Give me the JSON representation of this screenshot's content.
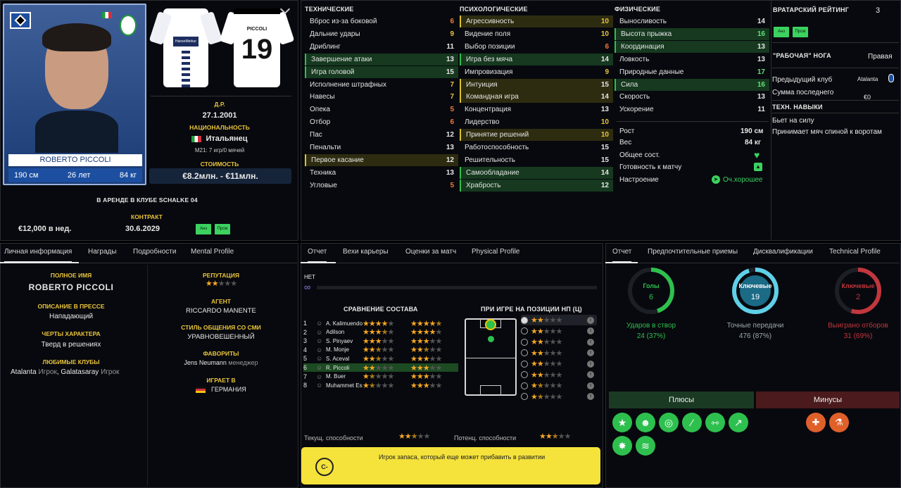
{
  "card": {
    "name": "ROBERTO PICCOLI",
    "height": "190 см",
    "age": "26 лет",
    "weight": "84 кг"
  },
  "dob_label": "Д.Р.",
  "dob": "27.1.2001",
  "nat_label": "НАЦИОНАЛЬНОСТЬ",
  "nationality": "Итальянец",
  "u21": "М21: 7 игр/0 мячей",
  "value_label": "СТОИМОСТЬ",
  "value": "€8.2млн. - €11млн.",
  "loan": "В АРЕНДЕ В КЛУБЕ SCHALKE 04",
  "contract_label": "КОНТРАКТ",
  "contract_date": "30.6.2029",
  "wage": "€12,000 в нед.",
  "badges": {
    "a": "Анз",
    "b": "Прсм"
  },
  "shirt_number": "19",
  "shirt_name": "PICCOLI",
  "sponsor": "HanseMerkur",
  "tech": {
    "title": "ТЕХНИЧЕСКИЕ",
    "items": [
      {
        "n": "Вброс из-за боковой",
        "v": "6"
      },
      {
        "n": "Дальние удары",
        "v": "9"
      },
      {
        "n": "Дриблинг",
        "v": "11"
      },
      {
        "n": "Завершение атаки",
        "v": "13"
      },
      {
        "n": "Игра головой",
        "v": "15"
      },
      {
        "n": "Исполнение штрафных",
        "v": "7"
      },
      {
        "n": "Навесы",
        "v": "7"
      },
      {
        "n": "Опека",
        "v": "5"
      },
      {
        "n": "Отбор",
        "v": "6"
      },
      {
        "n": "Пас",
        "v": "12"
      },
      {
        "n": "Пенальти",
        "v": "13"
      },
      {
        "n": "Первое касание",
        "v": "12"
      },
      {
        "n": "Техника",
        "v": "13"
      },
      {
        "n": "Угловые",
        "v": "5"
      }
    ]
  },
  "ment": {
    "title": "ПСИХОЛОГИЧЕСКИЕ",
    "items": [
      {
        "n": "Агрессивность",
        "v": "10"
      },
      {
        "n": "Видение поля",
        "v": "10"
      },
      {
        "n": "Выбор позиции",
        "v": "6"
      },
      {
        "n": "Игра без мяча",
        "v": "14"
      },
      {
        "n": "Импровизация",
        "v": "9"
      },
      {
        "n": "Интуиция",
        "v": "15"
      },
      {
        "n": "Командная игра",
        "v": "14"
      },
      {
        "n": "Концентрация",
        "v": "13"
      },
      {
        "n": "Лидерство",
        "v": "10"
      },
      {
        "n": "Принятие решений",
        "v": "10"
      },
      {
        "n": "Работоспособность",
        "v": "15"
      },
      {
        "n": "Решительность",
        "v": "15"
      },
      {
        "n": "Самообладание",
        "v": "14"
      },
      {
        "n": "Храбрость",
        "v": "12"
      }
    ]
  },
  "phys": {
    "title": "ФИЗИЧЕСКИЕ",
    "items": [
      {
        "n": "Выносливость",
        "v": "14"
      },
      {
        "n": "Высота прыжка",
        "v": "16"
      },
      {
        "n": "Координация",
        "v": "13"
      },
      {
        "n": "Ловкость",
        "v": "13"
      },
      {
        "n": "Природные данные",
        "v": "17"
      },
      {
        "n": "Сила",
        "v": "16"
      },
      {
        "n": "Скорость",
        "v": "13"
      },
      {
        "n": "Ускорение",
        "v": "11"
      }
    ]
  },
  "body": {
    "h_label": "Рост",
    "h": "190 см",
    "w_label": "Вес",
    "w": "84 кг",
    "cond_label": "Общее сост.",
    "ready_label": "Готовность к матчу",
    "mood_label": "Настроение",
    "mood": "Оч.хорошее"
  },
  "gk": {
    "label": "ВРАТАРСКИЙ РЕЙТИНГ",
    "value": "3"
  },
  "foot": {
    "label": "\"РАБОЧАЯ\" НОГА",
    "value": "Правая"
  },
  "prev": {
    "label": "Предыдущий клуб",
    "value": "Atalanta",
    "fee_label": "Сумма последнего",
    "fee": "€0"
  },
  "skills": {
    "title": "ТЕХН. НАВЫКИ",
    "items": [
      "Бьет на силу",
      "Принимает мяч спиной к воротам"
    ]
  },
  "info_tabs": [
    "Личная информация",
    "Награды",
    "Подробности",
    "Mental Profile"
  ],
  "info": {
    "full_label": "ПОЛНОЕ ИМЯ",
    "full": "ROBERTO PICCOLI",
    "press_label": "ОПИСАНИЕ В ПРЕССЕ",
    "press": "Нападающий",
    "trait_label": "ЧЕРТЫ ХАРАКТЕРА",
    "trait": "Тверд в решениях",
    "clubs_label": "ЛЮБИМЫЕ КЛУБЫ",
    "club1": "Atalanta",
    "role1": "Игрок",
    "club2": "Galatasaray",
    "role2": "Игрок",
    "rep_label": "РЕПУТАЦИЯ",
    "agent_label": "АГЕНТ",
    "agent": "RICCARDO MANENTE",
    "media_label": "СТИЛЬ ОБЩЕНИЯ СО СМИ",
    "media": "УРАВНОВЕШЕННЫЙ",
    "fav_label": "ФАВОРИТЫ",
    "fav": "Jens Neumann",
    "fav_role": "менеджер",
    "plays_label": "ИГРАЕТ В",
    "plays": "ГЕРМАНИЯ"
  },
  "mid_tabs": [
    "Отчет",
    "Вехи карьеры",
    "Оценки за матч",
    "Physical Profile"
  ],
  "net": "НЕТ",
  "compare_title": "СРАВНЕНИЕ СОСТАВА",
  "position_title": "ПРИ ИГРЕ НА ПОЗИЦИИ НП (Ц)",
  "squad": [
    {
      "n": "1",
      "name": "A. Kalimuendo"
    },
    {
      "n": "2",
      "name": "Adilson"
    },
    {
      "n": "3",
      "name": "S. Pinyaev"
    },
    {
      "n": "4",
      "name": "M. Monje"
    },
    {
      "n": "5",
      "name": "S. Aceval"
    },
    {
      "n": "6",
      "name": "R. Piccoli"
    },
    {
      "n": "7",
      "name": "M. Buer"
    },
    {
      "n": "8",
      "name": "Muhammet Esenli"
    }
  ],
  "cur_label": "Текущ. способности",
  "pot_label": "Потенц. способности",
  "scout_grade": "C-",
  "scout_text": "Игрок запаса, который еще может прибавить в развитии",
  "right_tabs": [
    "Отчет",
    "Предпочтительные приемы",
    "Дисквалификации",
    "Technical Profile"
  ],
  "rings": [
    {
      "label": "Голы",
      "value": "6",
      "stat": "Ударов в створ",
      "sub": "24 (37%)"
    },
    {
      "label": "Ключевые",
      "value": "19",
      "stat": "Точные передачи",
      "sub": "476 (87%)"
    },
    {
      "label": "Ключевые",
      "value": "2",
      "stat": "Выиграно отборов",
      "sub": "31 (69%)"
    }
  ],
  "plus_title": "Плюсы",
  "minus_title": "Минусы",
  "colors": {
    "green": "#2ec04e",
    "yellow": "#e9c43b",
    "red": "#c2363d",
    "cyan": "#5fd0e8"
  }
}
